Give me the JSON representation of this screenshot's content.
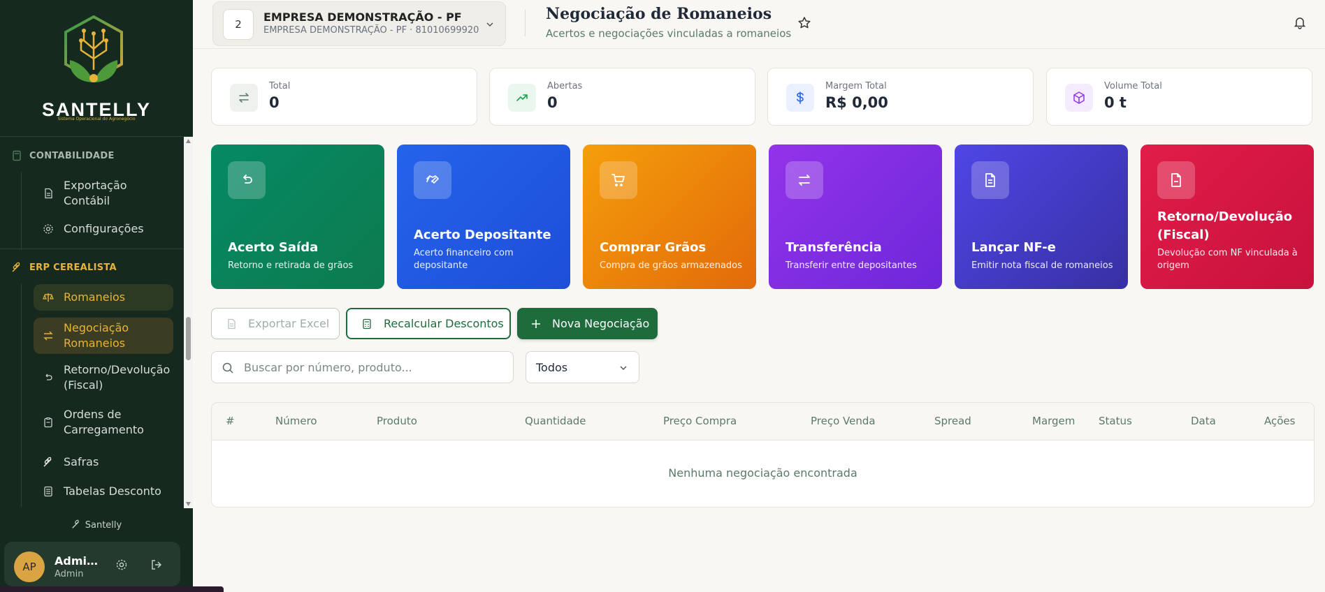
{
  "sidebar": {
    "brand": "SANTELLY",
    "tagline": "Sistema Operacional do Agronegócio",
    "sections": [
      {
        "label": "CONTABILIDADE"
      },
      {
        "label": "ERP CEREALISTA"
      }
    ],
    "items": [
      {
        "label": "Exportação Contábil",
        "icon": "file-icon"
      },
      {
        "label": "Configurações",
        "icon": "gear-icon"
      },
      {
        "label": "Romaneios",
        "icon": "scale-icon"
      },
      {
        "label": "Negociação Romaneios",
        "icon": "arrows-icon"
      },
      {
        "label": "Retorno/Devolução (Fiscal)",
        "icon": "undo-icon"
      },
      {
        "label": "Ordens de Carregamento",
        "icon": "clipboard-icon"
      },
      {
        "label": "Safras",
        "icon": "wheat-icon"
      },
      {
        "label": "Tabelas Desconto",
        "icon": "table-icon"
      }
    ],
    "footer_name": "Santelly",
    "user": {
      "initials": "AP",
      "name": "Administrador",
      "role": "Admin"
    }
  },
  "header": {
    "company": {
      "number": "2",
      "name": "EMPRESA DEMONSTRAÇÃO - PF",
      "sub": "EMPRESA DEMONSTRAÇÃO - PF · 81010699920"
    },
    "title": "Negociação de Romaneios",
    "subtitle": "Acertos e negociações vinculadas a romaneios"
  },
  "stats": [
    {
      "label": "Total",
      "value": "0",
      "icon": "swap-icon",
      "color": "#5b7a67",
      "bg": "#eef1ee"
    },
    {
      "label": "Abertas",
      "value": "0",
      "icon": "trending-up-icon",
      "color": "#16a34a",
      "bg": "#e9f7ee"
    },
    {
      "label": "Margem Total",
      "value": "R$ 0,00",
      "icon": "dollar-icon",
      "color": "#2563eb",
      "bg": "#eaf0fd"
    },
    {
      "label": "Volume Total",
      "value": "0 t",
      "icon": "box-icon",
      "color": "#9333ea",
      "bg": "#f4ecfd"
    }
  ],
  "cards": [
    {
      "title": "Acerto Saída",
      "desc": "Retorno e retirada de grãos",
      "icon": "undo-icon"
    },
    {
      "title": "Acerto Depositante",
      "desc": "Acerto financeiro com depositante",
      "icon": "handshake-icon"
    },
    {
      "title": "Comprar Grãos",
      "desc": "Compra de grãos armazenados",
      "icon": "cart-icon"
    },
    {
      "title": "Transferência",
      "desc": "Transferir entre depositantes",
      "icon": "swap-icon"
    },
    {
      "title": "Lançar NF-e",
      "desc": "Emitir nota fiscal de romaneios",
      "icon": "document-icon"
    },
    {
      "title": "Retorno/Devolução (Fiscal)",
      "desc": "Devolução com NF vinculada à origem",
      "icon": "file-minus-icon"
    }
  ],
  "card_colors": [
    "#0b8a62",
    "#1d4ed8",
    "#ea7c0c",
    "#7e22ce",
    "#4338ca",
    "#db1646"
  ],
  "actions": {
    "export": "Exportar Excel",
    "recalc": "Recalcular Descontos",
    "new": "Nova Negociação"
  },
  "filters": {
    "search_placeholder": "Buscar por número, produto...",
    "status_value": "Todos"
  },
  "table": {
    "columns": [
      "#",
      "Número",
      "Produto",
      "Quantidade",
      "Preço Compra",
      "Preço Venda",
      "Spread",
      "Margem",
      "Status",
      "Data",
      "Ações"
    ],
    "empty": "Nenhuma negociação encontrada"
  },
  "theme": {
    "sidebar_bg": "#16291f",
    "accent": "#e8b33a",
    "primary": "#1e6b3c"
  }
}
